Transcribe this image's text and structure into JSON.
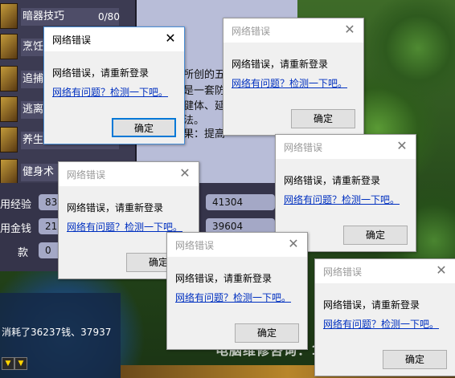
{
  "skills": [
    {
      "label": "暗器技巧",
      "count": "0/80"
    },
    {
      "label": "烹饪",
      "count": ""
    },
    {
      "label": "追捕",
      "count": ""
    },
    {
      "label": "逃离",
      "count": ""
    },
    {
      "label": "养生",
      "count": ""
    },
    {
      "label": "健身术",
      "count": ""
    }
  ],
  "description": {
    "lines": [
      "所创的五",
      "是一套防",
      "健体、延",
      "法。",
      "果：提高"
    ]
  },
  "stats": {
    "exp_label": "用经验",
    "exp_value": "830",
    "exp_value2": "41304",
    "money_label": "用金钱",
    "money_value": "210",
    "money_value2": "39604",
    "loan_label": "款",
    "loan_value": "0"
  },
  "chat": {
    "message": "消耗了36237钱、37937"
  },
  "watermark": "电脑维修咨询：13813851595",
  "dialogs": [
    {
      "title": "网络错误",
      "message": "网络错误，请重新登录",
      "link": "网络有问题？检测一下吧。",
      "button": "确定",
      "close": "✕"
    },
    {
      "title": "网络错误",
      "message": "网络错误，请重新登录",
      "link": "网络有问题？检测一下吧。",
      "button": "确定",
      "close": "✕"
    },
    {
      "title": "网络错误",
      "message": "网络错误，请重新登录",
      "link": "网络有问题？检测一下吧。",
      "button": "确定",
      "close": "✕"
    },
    {
      "title": "网络错误",
      "message": "网络错误，请重新登录",
      "link": "网络有问题？检测一下吧。",
      "button": "确定",
      "close": "✕"
    },
    {
      "title": "网络错误",
      "message": "网络错误，请重新登录",
      "link": "网络有问题？检测一下吧。",
      "button": "确定",
      "close": "✕"
    },
    {
      "title": "网络错误",
      "message": "网络错误，请重新登录",
      "link": "网络有问题？检测一下吧。",
      "button": "确定",
      "close": "✕"
    }
  ]
}
